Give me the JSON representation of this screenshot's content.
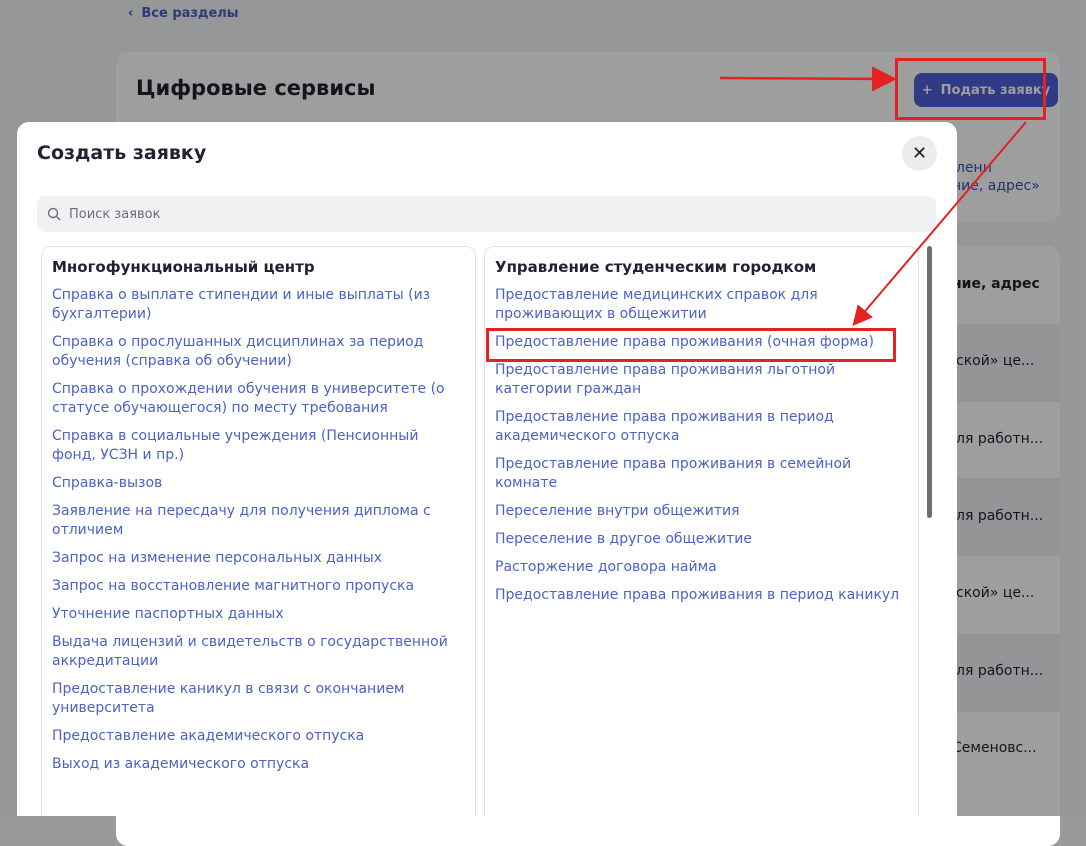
{
  "background": {
    "back_link": "Все разделы",
    "title": "Цифровые сервисы",
    "submit_button": "Подать заявку",
    "right_snippets": [
      "лени",
      "ние, адрес»"
    ],
    "column_header": "ние, адрес",
    "rows": [
      "ской» це...",
      "ля работн...",
      "ля работн...",
      "ской» це...",
      "ля работн...",
      "Семеновс..."
    ]
  },
  "modal": {
    "title": "Создать заявку",
    "close_icon": "close-icon",
    "search_placeholder": "Поиск заявок",
    "left_column": {
      "title": "Многофункциональный центр",
      "items": [
        "Справка о выплате стипендии и иные выплаты (из бухгалтерии)",
        "Справка о прослушанных дисциплинах за период обучения (справка об обучении)",
        "Справка о прохождении обучения в университете (о статусе обучающегося) по месту требования",
        "Справка в социальные учреждения (Пенсионный фонд, УСЗН и пр.)",
        "Справка-вызов",
        "Заявление на пересдачу для получения диплома с отличием",
        "Запрос на изменение персональных данных",
        "Запрос на восстановление магнитного пропуска",
        "Уточнение паспортных данных",
        "Выдача лицензий и свидетельств о государственной аккредитации",
        "Предоставление каникул в связи с окончанием университета",
        "Предоставление академического отпуска",
        "Выход из академического отпуска"
      ]
    },
    "right_column": {
      "title": "Управление студенческим городком",
      "items": [
        "Предоставление медицинских справок для проживающих в общежитии",
        "Предоставление права проживания (очная форма)",
        "Предоставление права проживания льготной категории граждан",
        "Предоставление права проживания в период академического отпуска",
        "Предоставление права проживания в семейной комнате",
        "Переселение внутри общежития",
        "Переселение в другое общежитие",
        "Расторжение договора найма",
        "Предоставление права проживания в период каникул"
      ]
    }
  },
  "annotation": {
    "color": "#e32222"
  }
}
